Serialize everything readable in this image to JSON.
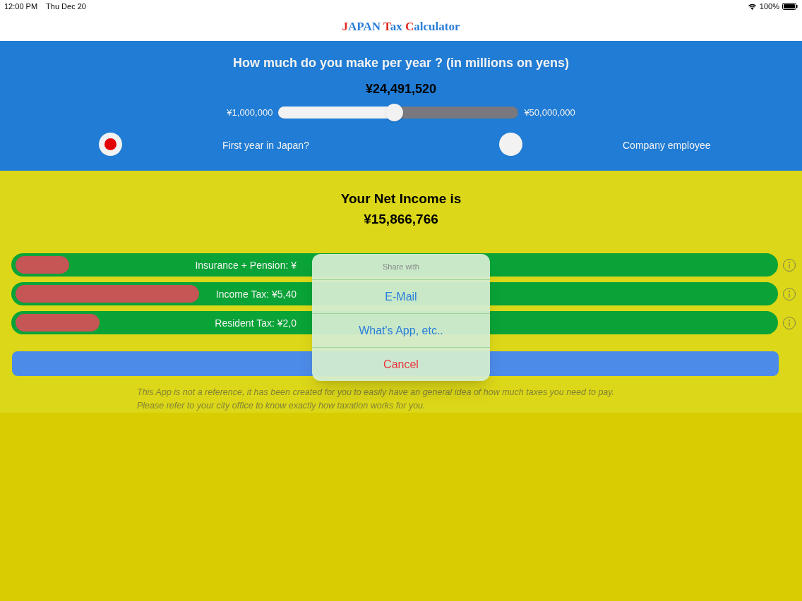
{
  "status_bar": {
    "time": "12:00 PM",
    "date": "Thu Dec 20",
    "battery": "100%"
  },
  "title_parts": [
    {
      "text": "J",
      "highlight": true
    },
    {
      "text": "APAN ",
      "highlight": false
    },
    {
      "text": "T",
      "highlight": true
    },
    {
      "text": "ax ",
      "highlight": false
    },
    {
      "text": "C",
      "highlight": true
    },
    {
      "text": "alculator",
      "highlight": false
    }
  ],
  "income": {
    "question": "How much do you make per year ? (in millions on yens)",
    "value": "¥24,491,520",
    "min_label": "¥1,000,000",
    "max_label": "¥50,000,000",
    "level": 0.48
  },
  "options": [
    {
      "label": "First year in Japan?",
      "checked": true
    },
    {
      "label": "Company employee",
      "checked": false
    }
  ],
  "result": {
    "heading": "Your Net Income is",
    "amount": "¥15,866,766"
  },
  "breakdown": [
    {
      "label": "Insurance + Pension: ¥",
      "level": 0.07
    },
    {
      "label": "Income Tax: ¥5,40",
      "level": 0.24
    },
    {
      "label": "Resident Tax: ¥2,0",
      "level": 0.11
    }
  ],
  "disclaimer": [
    "This App is not a reference, it has been created for you to easily have an general idea of how much taxes you need to pay.",
    "Please refer to your city office to know exactly how taxation works for you."
  ],
  "share_sheet": {
    "title": "Share with",
    "actions": [
      {
        "label": "E-Mail",
        "kind": "default"
      },
      {
        "label": "What's App, etc..",
        "kind": "default"
      },
      {
        "label": "Cancel",
        "kind": "destructive"
      }
    ]
  }
}
